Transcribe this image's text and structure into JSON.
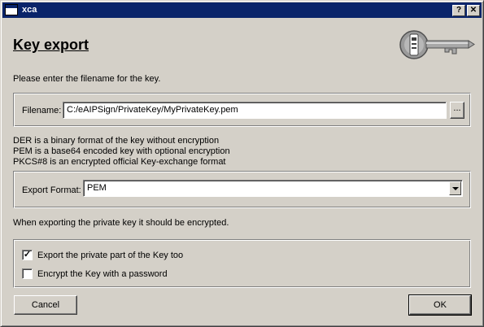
{
  "window": {
    "title": "xca"
  },
  "titlebar": {
    "help_label": "?",
    "close_label": "✕"
  },
  "heading": "Key export",
  "instruction": "Please enter the filename for the key.",
  "filename": {
    "label": "Filename:",
    "value": "C:/eAIPSign/PrivateKey/MyPrivateKey.pem",
    "browse_label": "..."
  },
  "formats_info": [
    "DER is a binary format of the key without encryption",
    "PEM is a base64 encoded key with optional encryption",
    "PKCS#8 is an encrypted official Key-exchange format"
  ],
  "export_format": {
    "label": "Export Format:",
    "selected": "PEM"
  },
  "encrypt_note": "When exporting the private key it should be encrypted.",
  "options": {
    "export_private": {
      "label": "Export the private part of the Key too",
      "checked": true,
      "mark": "✓"
    },
    "encrypt_password": {
      "label": "Encrypt the Key with a password",
      "checked": false,
      "mark": ""
    }
  },
  "buttons": {
    "cancel": "Cancel",
    "ok": "OK"
  }
}
